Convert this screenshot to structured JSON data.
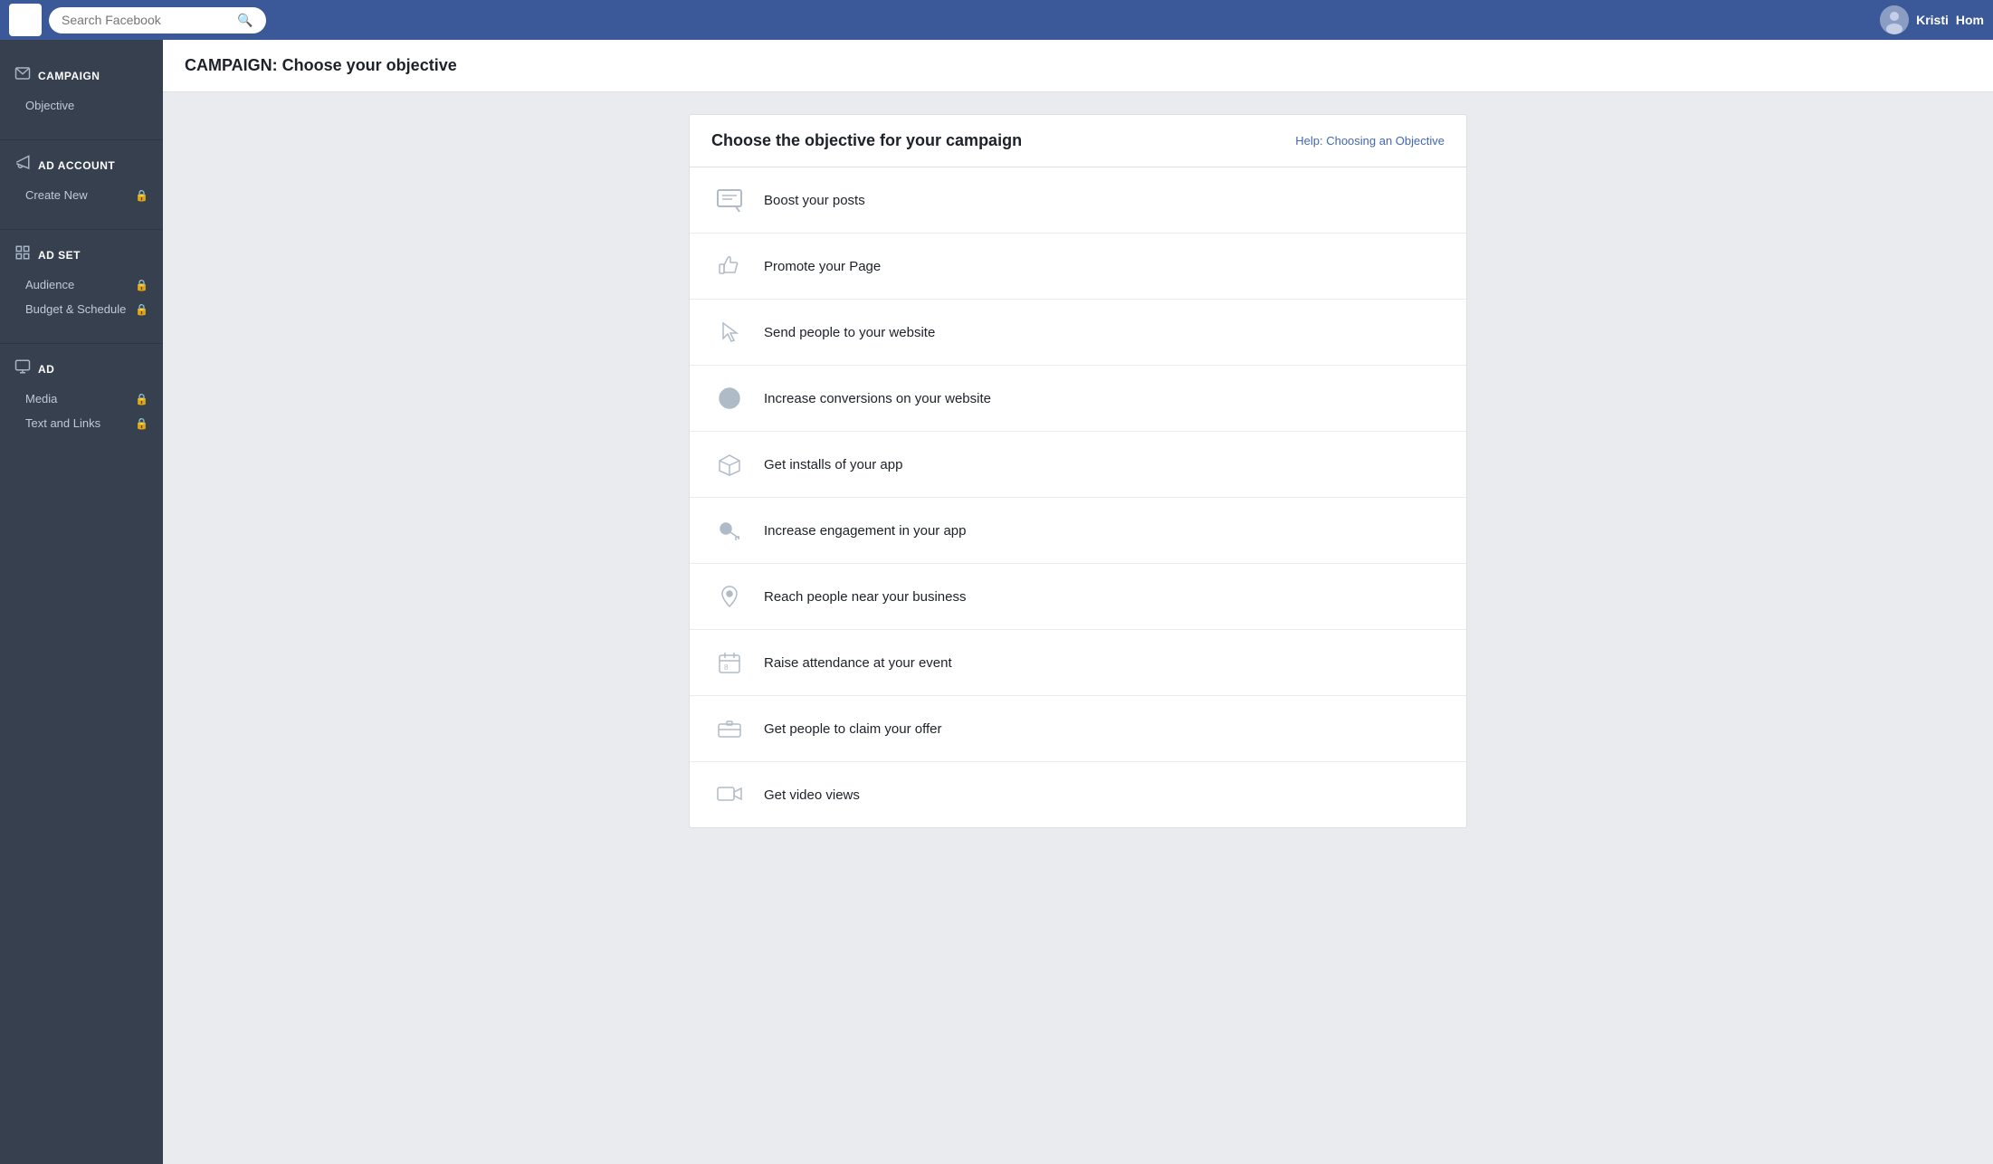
{
  "topnav": {
    "search_placeholder": "Search Facebook",
    "username": "Kristi",
    "home_label": "Hom"
  },
  "page_header": {
    "campaign_label": "CAMPAIGN:",
    "subtitle": "Choose your objective"
  },
  "sidebar": {
    "sections": [
      {
        "id": "campaign",
        "icon": "envelope-icon",
        "label": "CAMPAIGN",
        "items": [
          {
            "label": "Objective",
            "locked": false
          }
        ]
      },
      {
        "id": "ad-account",
        "icon": "megaphone-icon",
        "label": "AD ACCOUNT",
        "items": [
          {
            "label": "Create New",
            "locked": true
          }
        ]
      },
      {
        "id": "ad-set",
        "icon": "grid-icon",
        "label": "AD SET",
        "items": [
          {
            "label": "Audience",
            "locked": true
          },
          {
            "label": "Budget & Schedule",
            "locked": true
          }
        ]
      },
      {
        "id": "ad",
        "icon": "monitor-icon",
        "label": "AD",
        "items": [
          {
            "label": "Media",
            "locked": true
          },
          {
            "label": "Text and Links",
            "locked": true
          }
        ]
      }
    ]
  },
  "objective_card": {
    "title": "Choose the objective for your campaign",
    "help_link": "Help: Choosing an Objective",
    "objectives": [
      {
        "id": "boost-posts",
        "label": "Boost your posts",
        "icon": "boost-icon"
      },
      {
        "id": "promote-page",
        "label": "Promote your Page",
        "icon": "thumbsup-icon"
      },
      {
        "id": "send-website",
        "label": "Send people to your website",
        "icon": "cursor-icon"
      },
      {
        "id": "increase-conversions",
        "label": "Increase conversions on your website",
        "icon": "globe-icon"
      },
      {
        "id": "app-installs",
        "label": "Get installs of your app",
        "icon": "box-icon"
      },
      {
        "id": "app-engagement",
        "label": "Increase engagement in your app",
        "icon": "key-icon"
      },
      {
        "id": "local-awareness",
        "label": "Reach people near your business",
        "icon": "pin-icon"
      },
      {
        "id": "event-responses",
        "label": "Raise attendance at your event",
        "icon": "event-icon"
      },
      {
        "id": "offer-claims",
        "label": "Get people to claim your offer",
        "icon": "offer-icon"
      },
      {
        "id": "video-views",
        "label": "Get video views",
        "icon": "video-icon"
      }
    ]
  }
}
